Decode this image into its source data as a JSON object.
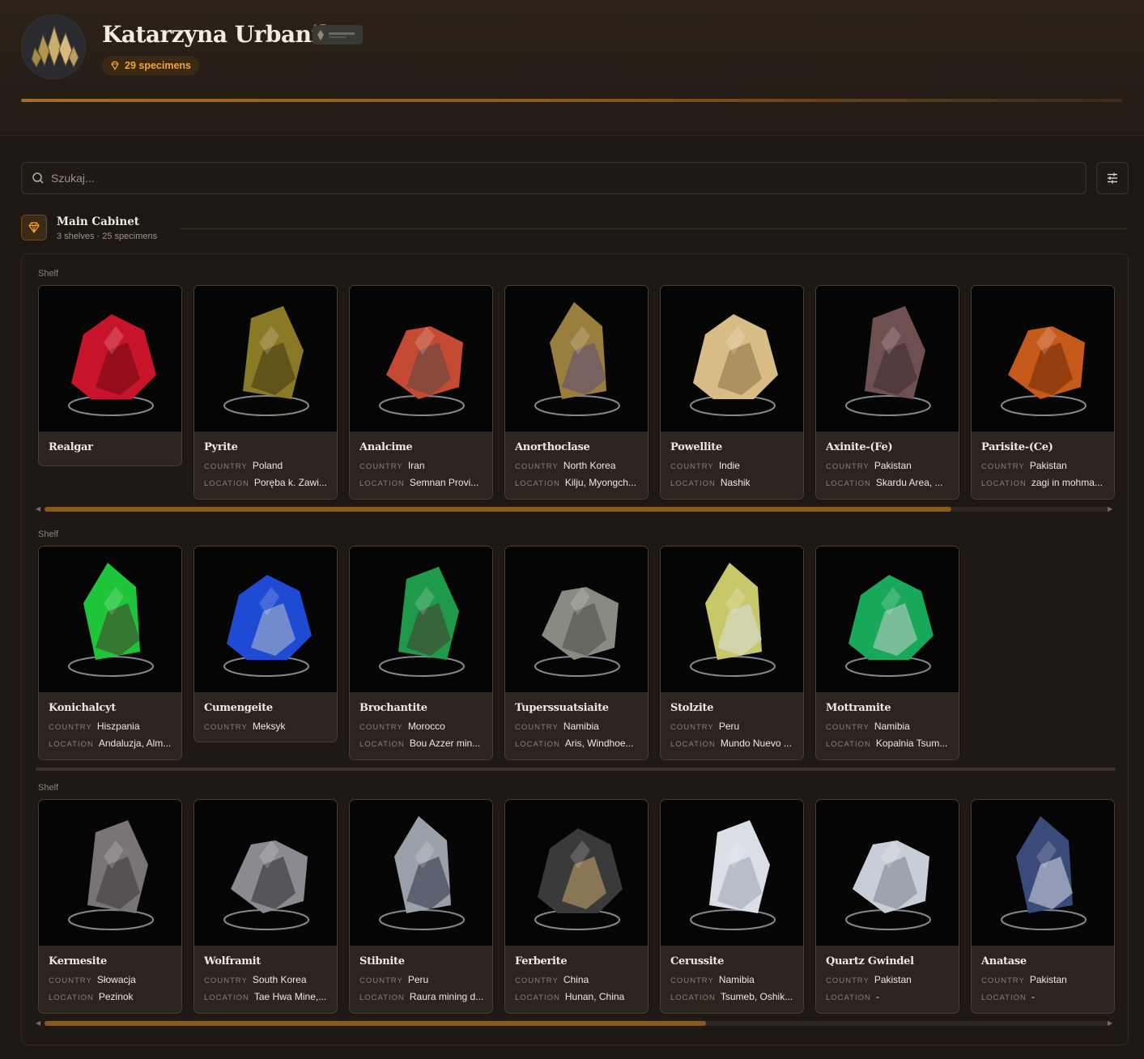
{
  "header": {
    "owner_name": "Katarzyna Urbanik",
    "specimen_count": "29 specimens",
    "avatar_icon": "crystal-cluster-icon",
    "accent": "#f2a33a"
  },
  "search": {
    "placeholder": "Szukaj..."
  },
  "cabinet": {
    "title": "Main Cabinet",
    "meta": "3 shelves · 25 specimens"
  },
  "labels": {
    "country": "COUNTRY",
    "location": "LOCATION"
  },
  "shelves": [
    {
      "label": "Shelf",
      "scroll_position": 0.85,
      "cards": [
        {
          "name": "Realgar",
          "country": "",
          "location": "",
          "colors": [
            "#c8142a",
            "#6e0812"
          ]
        },
        {
          "name": "Pyrite",
          "country": "Poland",
          "location": "Poręba k. Zawi...",
          "colors": [
            "#8a7a28",
            "#3e3410"
          ]
        },
        {
          "name": "Analcime",
          "country": "Iran",
          "location": "Semnan Provi...",
          "colors": [
            "#c44a34",
            "#5a4a44"
          ]
        },
        {
          "name": "Anorthoclase",
          "country": "North Korea",
          "location": "Kilju, Myongch...",
          "colors": [
            "#9a7e3e",
            "#5c4a7a"
          ]
        },
        {
          "name": "Powellite",
          "country": "Indie",
          "location": "Nashik",
          "colors": [
            "#d8bc86",
            "#8a6e42"
          ]
        },
        {
          "name": "Axinite-(Fe)",
          "country": "Pakistan",
          "location": "Skardu Area, ...",
          "colors": [
            "#6e5050",
            "#3a2a2e"
          ]
        },
        {
          "name": "Parisite-(Ce)",
          "country": "Pakistan",
          "location": "zagi in mohma...",
          "colors": [
            "#c65a1a",
            "#6e2a0a"
          ]
        }
      ]
    },
    {
      "label": "Shelf",
      "cards": [
        {
          "name": "Konichalcyt",
          "country": "Hiszpania",
          "location": "Andaluzja, Alm...",
          "colors": [
            "#1ec43a",
            "#4a3a2a"
          ]
        },
        {
          "name": "Cumengeite",
          "country": "Meksyk",
          "location": "",
          "colors": [
            "#1e4ad4",
            "#b8c0c8"
          ]
        },
        {
          "name": "Brochantite",
          "country": "Morocco",
          "location": "Bou Azzer min...",
          "colors": [
            "#1e9a4a",
            "#4a3a30"
          ]
        },
        {
          "name": "Tuperssuatsiaite",
          "country": "Namibia",
          "location": "Aris, Windhoe...",
          "colors": [
            "#8a8a82",
            "#4a4a44"
          ]
        },
        {
          "name": "Stolzite",
          "country": "Peru",
          "location": "Mundo Nuevo ...",
          "colors": [
            "#c8c86a",
            "#d8dce0"
          ]
        },
        {
          "name": "Mottramite",
          "country": "Namibia",
          "location": "Kopalnia Tsum...",
          "colors": [
            "#18a85a",
            "#c8d0d0"
          ]
        }
      ]
    },
    {
      "label": "Shelf",
      "scroll_position": 0.62,
      "cards": [
        {
          "name": "Kermesite",
          "country": "Słowacja",
          "location": "Pezinok",
          "colors": [
            "#7a7474",
            "#3a3434"
          ]
        },
        {
          "name": "Wolframit",
          "country": "South Korea",
          "location": "Tae Hwa Mine,...",
          "colors": [
            "#8a8a90",
            "#2a2a30"
          ]
        },
        {
          "name": "Stibnite",
          "country": "Peru",
          "location": "Raura mining d...",
          "colors": [
            "#9aa0aa",
            "#2a3040"
          ]
        },
        {
          "name": "Ferberite",
          "country": "China",
          "location": "Hunan, China",
          "colors": [
            "#3a3a3a",
            "#c8a86a"
          ]
        },
        {
          "name": "Cerussite",
          "country": "Namibia",
          "location": "Tsumeb, Oshik...",
          "colors": [
            "#dadfe6",
            "#9aa2b0"
          ]
        },
        {
          "name": "Quartz Gwindel",
          "country": "Pakistan",
          "location": "-",
          "colors": [
            "#c8ced8",
            "#7a8290"
          ]
        },
        {
          "name": "Anatase",
          "country": "Pakistan",
          "location": "-",
          "colors": [
            "#3a4a7a",
            "#dadfe6"
          ]
        }
      ]
    }
  ]
}
